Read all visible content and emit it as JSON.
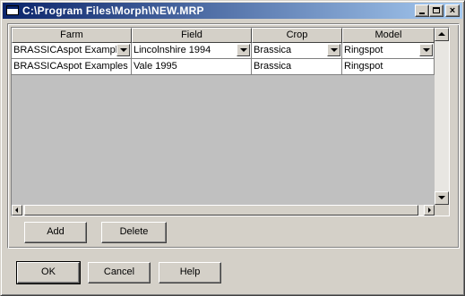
{
  "window": {
    "title": "C:\\Program Files\\Morph\\NEW.MRP",
    "minimize_icon": "minimize-icon",
    "maximize_icon": "maximize-icon",
    "close_icon": "close-icon",
    "close_glyph": "×"
  },
  "grid": {
    "columns": [
      "Farm",
      "Field",
      "Crop",
      "Model"
    ],
    "rows": [
      [
        "BRASSICAspot Examples",
        "Lincolnshire 1994",
        "Brassica",
        "Ringspot"
      ],
      [
        "BRASSICAspot Examples",
        "Vale 1995",
        "Brassica",
        "Ringspot"
      ]
    ],
    "dropdown_icon": "dropdown-arrow-icon"
  },
  "grid_buttons": {
    "add_label": "Add",
    "delete_label": "Delete"
  },
  "dialog_buttons": {
    "ok_label": "OK",
    "cancel_label": "Cancel",
    "help_label": "Help"
  },
  "colors": {
    "titlebar_start": "#0a246a",
    "titlebar_end": "#a6caf0",
    "face": "#d4d0c8",
    "grid_background": "#c0c0c0"
  }
}
